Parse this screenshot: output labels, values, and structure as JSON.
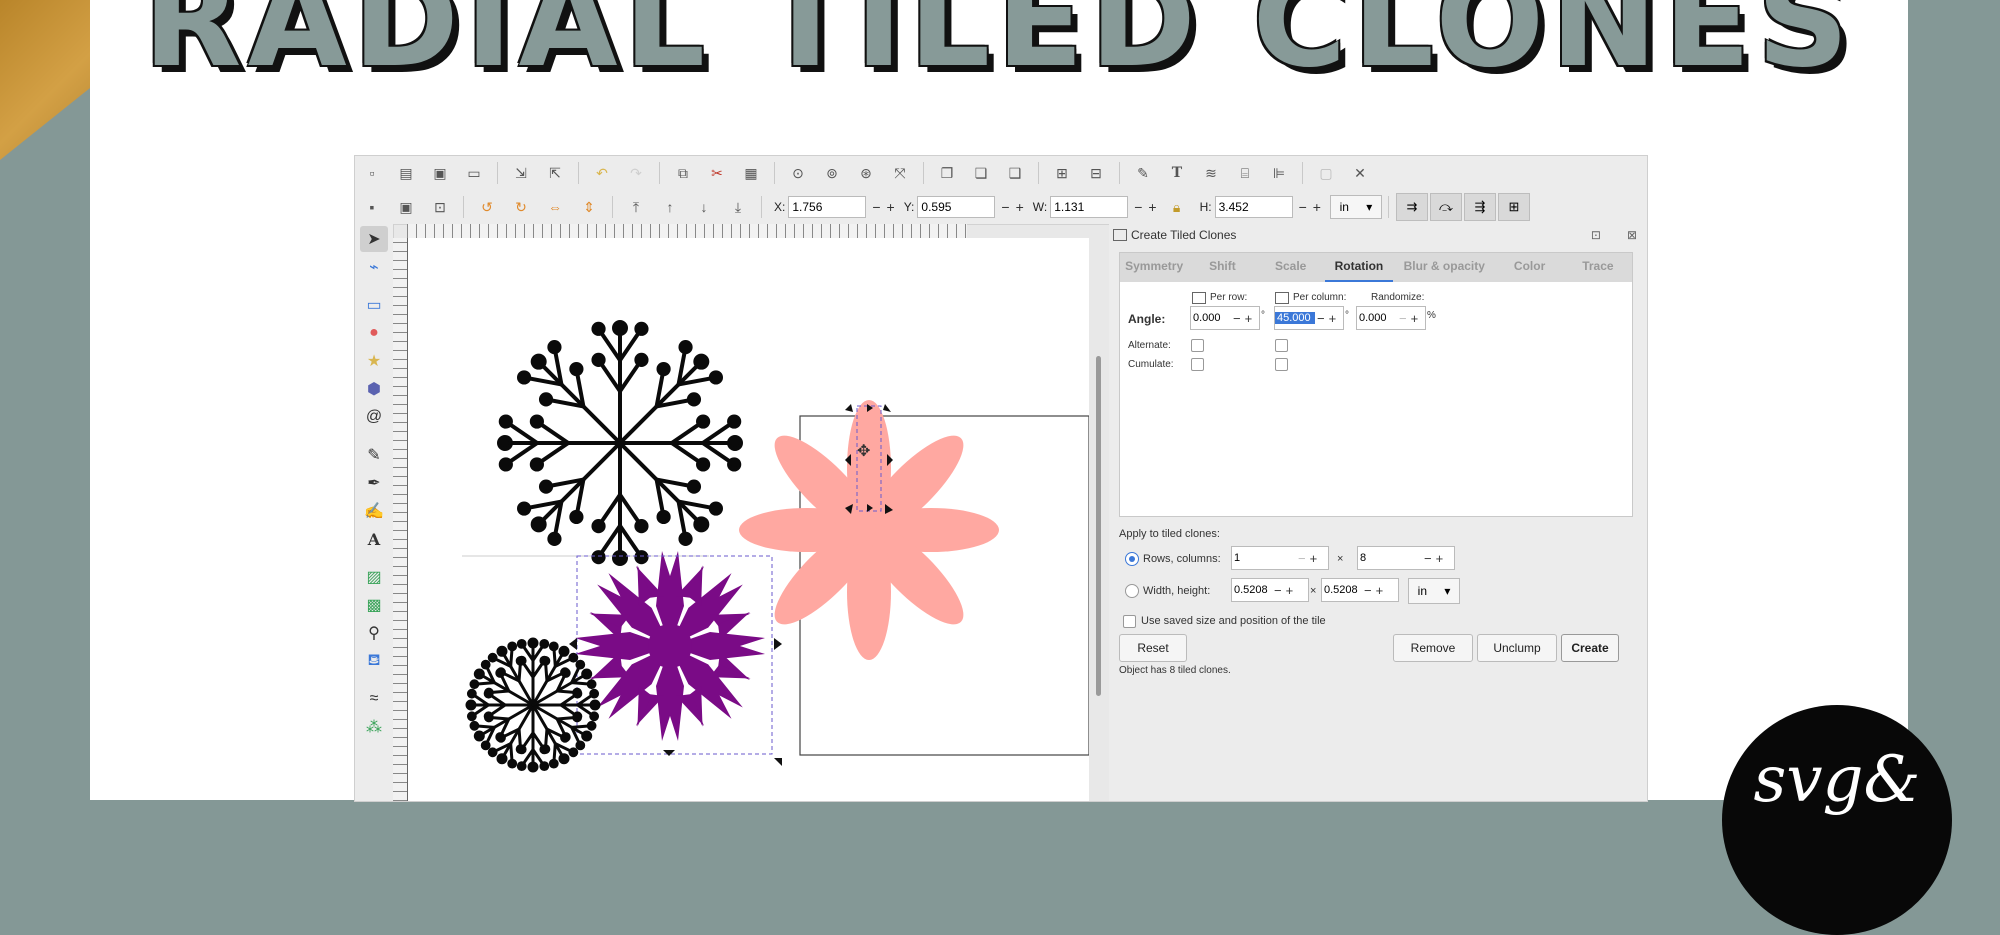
{
  "heading": "RADIAL TILED CLONES",
  "brand_text": "svg&",
  "colors": {
    "background": "#849896",
    "accent": "#3b78d8",
    "petal": "#ffa8a1",
    "purple": "#7a0b86"
  },
  "toolbar": {
    "x_label": "X:",
    "x_value": "1.756",
    "y_label": "Y:",
    "y_value": "0.595",
    "w_label": "W:",
    "w_value": "1.131",
    "h_label": "H:",
    "h_value": "3.452",
    "unit": "in"
  },
  "dialog": {
    "title": "Create Tiled Clones",
    "tabs": [
      "Symmetry",
      "Shift",
      "Scale",
      "Rotation",
      "Blur & opacity",
      "Color",
      "Trace"
    ],
    "active_tab": "Rotation",
    "per_row_label": "Per row:",
    "per_column_label": "Per column:",
    "randomize_label": "Randomize:",
    "angle_label": "Angle:",
    "angle_row": "0.000",
    "angle_col": "45.000",
    "randomize_value": "0.000",
    "deg": "°",
    "pct": "%",
    "alternate_label": "Alternate:",
    "cumulate_label": "Cumulate:",
    "apply_label": "Apply to tiled clones:",
    "rows_cols_label": "Rows, columns:",
    "rows": "1",
    "times": "×",
    "cols": "8",
    "width_height_label": "Width, height:",
    "width": "0.5208",
    "height": "0.5208",
    "unit": "in",
    "use_saved_label": "Use saved size and position of the tile",
    "reset": "Reset",
    "remove": "Remove",
    "unclump": "Unclump",
    "create": "Create",
    "status": "Object has 8 tiled clones."
  }
}
